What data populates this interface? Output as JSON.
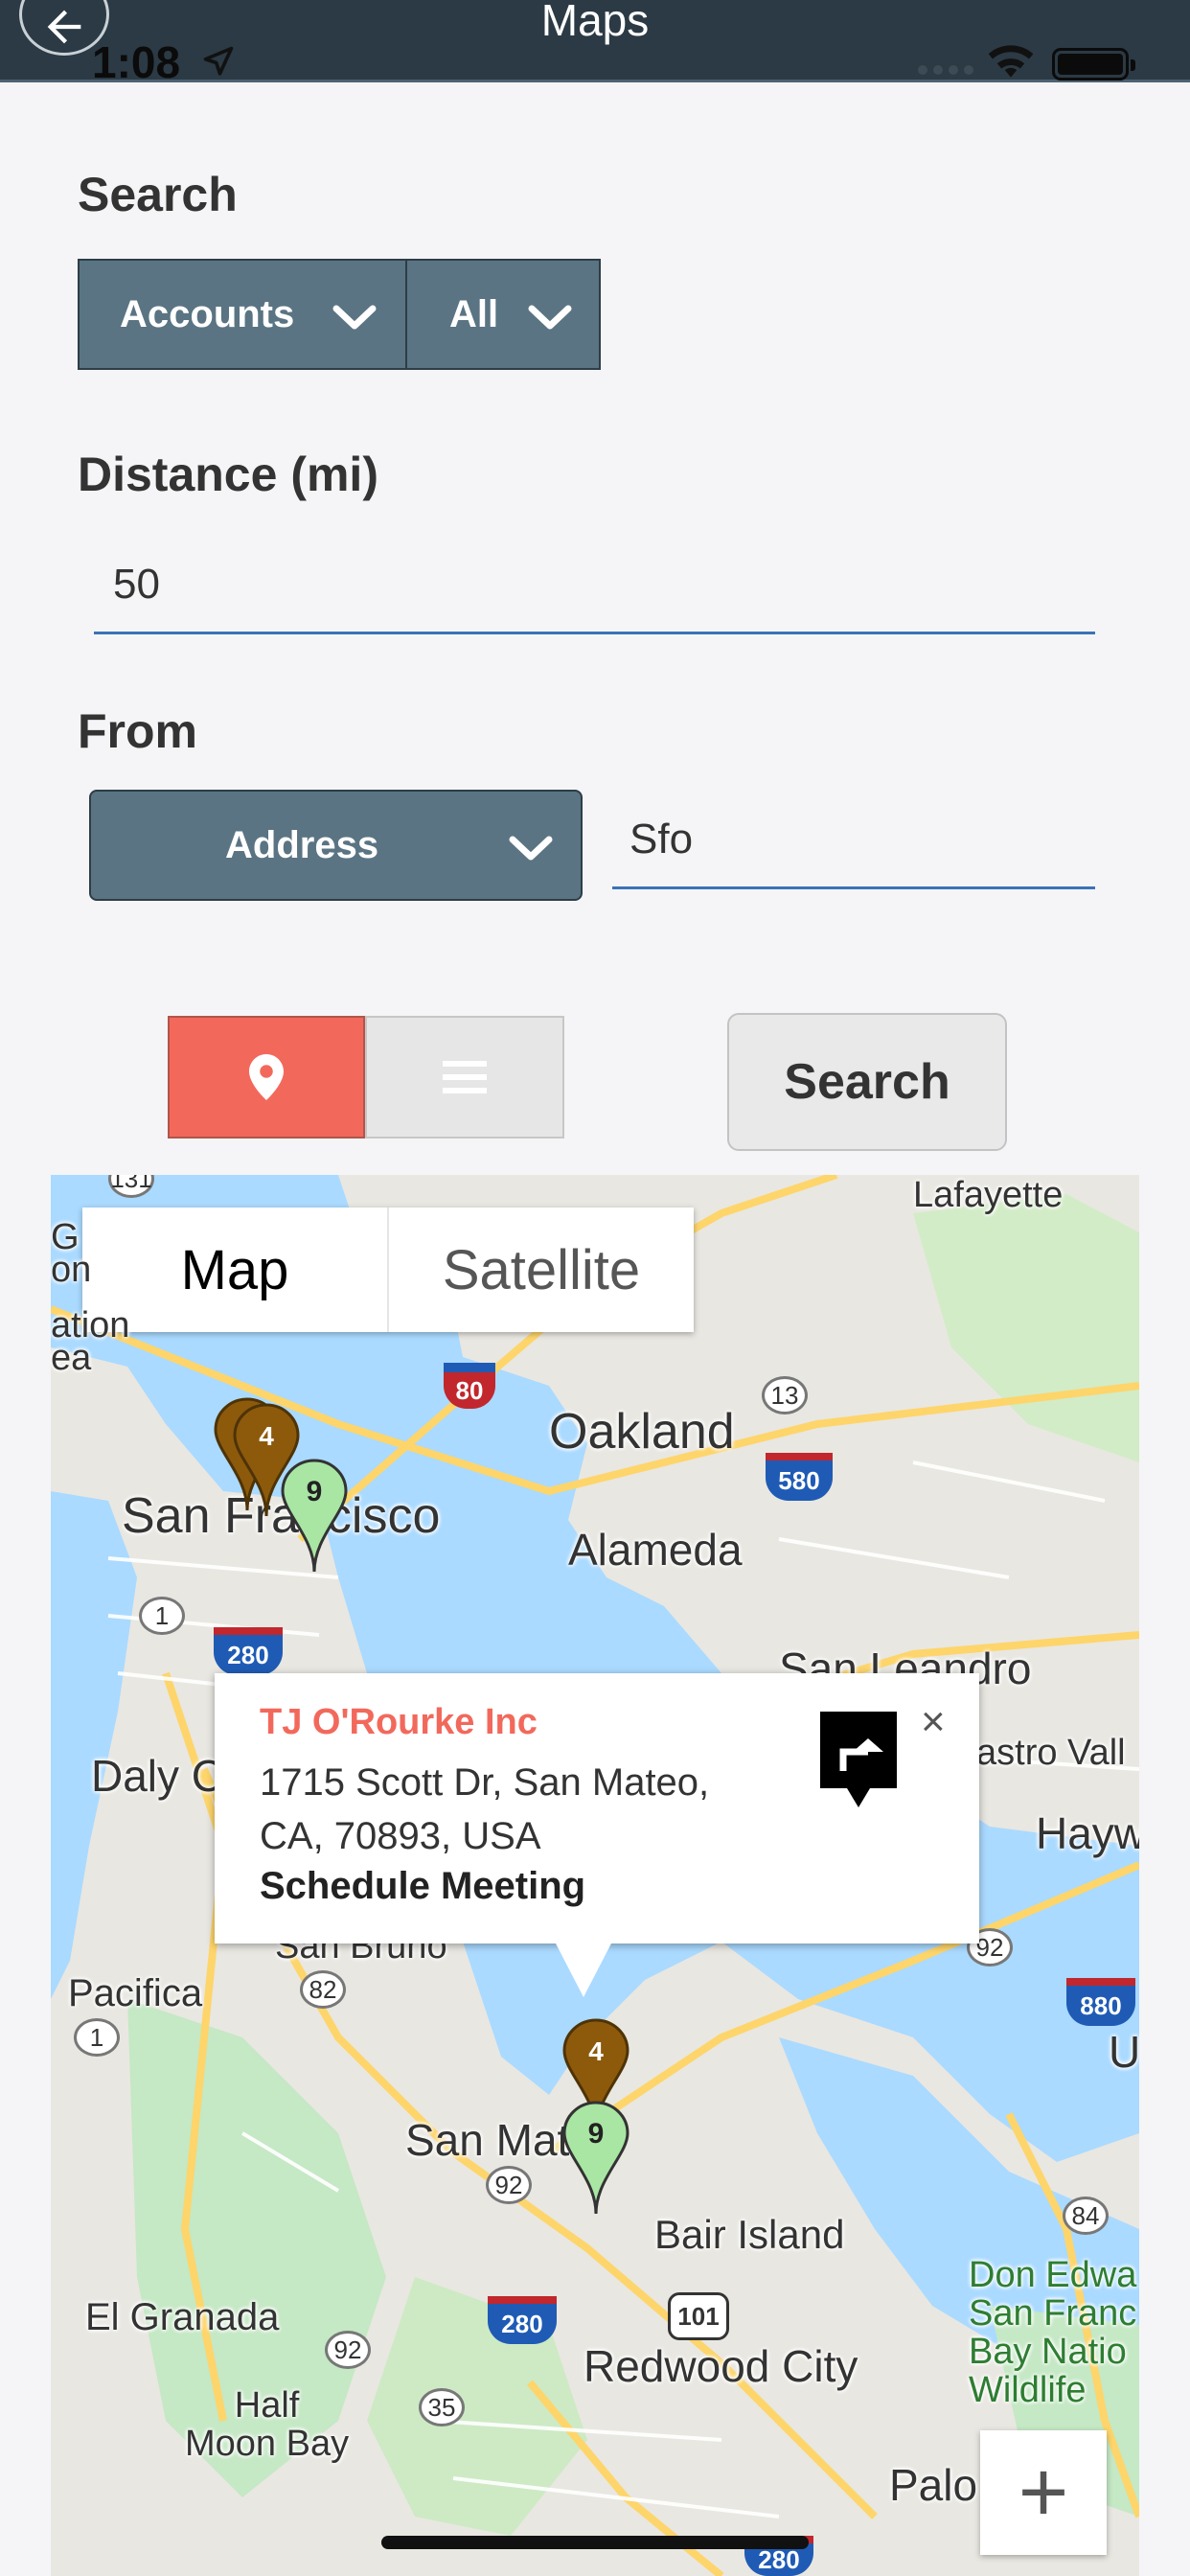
{
  "status": {
    "time": "1:08"
  },
  "header": {
    "title": "Maps"
  },
  "search": {
    "label": "Search",
    "object_type": "Accounts",
    "filter": "All"
  },
  "distance": {
    "label": "Distance (mi)",
    "value": "50"
  },
  "from": {
    "label": "From",
    "mode": "Address",
    "value": "Sfo"
  },
  "actions": {
    "search_label": "Search"
  },
  "map": {
    "type_map": "Map",
    "type_satellite": "Satellite",
    "places": {
      "lafayette": "Lafayette",
      "oakland": "Oakland",
      "san_francisco": "San Francisco",
      "alameda": "Alameda",
      "san_leandro": "San Leandro",
      "daly_city": "Daly C",
      "castro_valley": "astro Vall",
      "hayward": "Haywar",
      "san_bruno": "San Bruno",
      "pacifica": "Pacifica",
      "union_city": "Unic",
      "san_mateo": "San Mat",
      "bair_island": "Bair Island",
      "don_edwards": "Don Edwa\nSan Franc\nBay Natio\nWildlife",
      "el_granada": "El Granada",
      "redwood_city": "Redwood City",
      "half_moon_bay": "Half\nMoon Bay",
      "palo_alto": "Palo Al",
      "treasure": "ation\nea",
      "gate": "G\non"
    },
    "highways": [
      "131",
      "80",
      "13",
      "580",
      "1",
      "280",
      "92",
      "82",
      "1",
      "880",
      "84",
      "92",
      "101",
      "280",
      "92",
      "35",
      "280"
    ],
    "pins": [
      {
        "label": "4",
        "color": "#8d5a0c"
      },
      {
        "label": "9",
        "color": "#a9e6a4"
      },
      {
        "label": "4",
        "color": "#8d5a0c"
      },
      {
        "label": "9",
        "color": "#a9e6a4"
      }
    ],
    "popup": {
      "title": "TJ O'Rourke Inc",
      "address": "1715 Scott Dr, San Mateo, CA, 70893, USA",
      "action": "Schedule Meeting",
      "close": "×"
    },
    "zoom_in": "+"
  }
}
